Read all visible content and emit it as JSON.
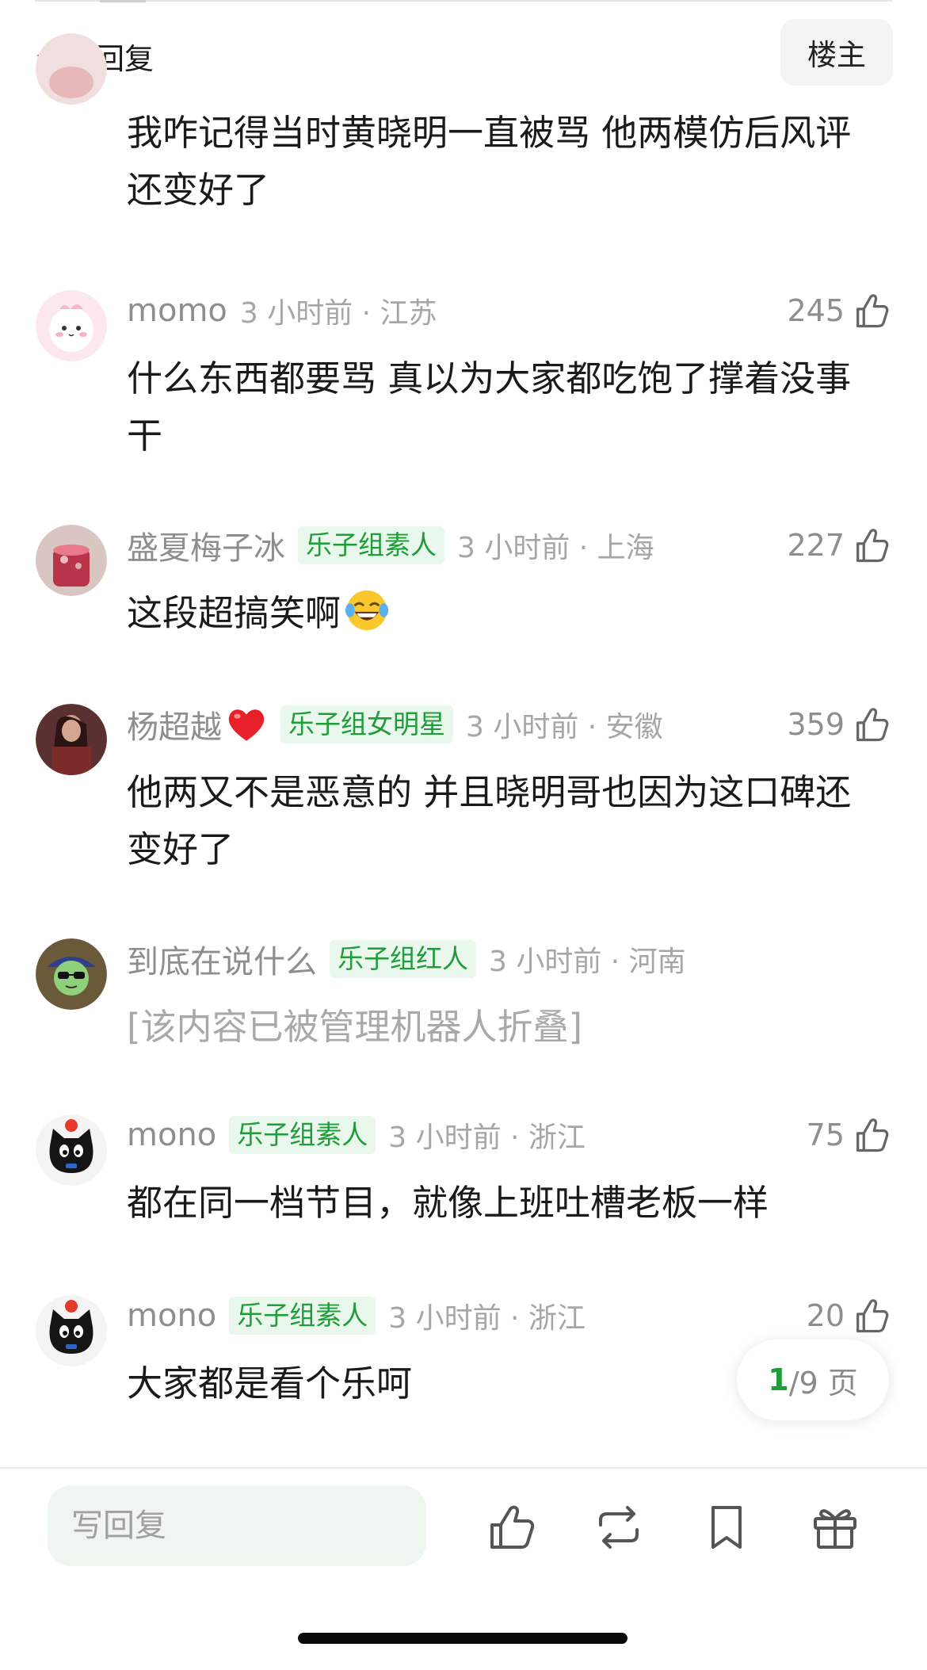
{
  "header": {
    "title": "全部回复",
    "op_label": "楼主"
  },
  "comments": [
    {
      "text": "我咋记得当时黄晓明一直被骂 他两模仿后风评还变好了"
    },
    {
      "user": "momo",
      "badge": "",
      "time_location": "3 小时前 · 江苏",
      "likes": "245",
      "text": "什么东西都要骂 真以为大家都吃饱了撑着没事干",
      "avatar": "pink-bunny-avatar"
    },
    {
      "user": "盛夏梅子冰",
      "badge": "乐子组素人",
      "time_location": "3 小时前 · 上海",
      "likes": "227",
      "text": "这段超搞笑啊",
      "avatar": "iced-drink-avatar",
      "emoji": "laughing-tears-emoji"
    },
    {
      "user": "杨超越",
      "badge": "乐子组女明星",
      "time_location": "3 小时前 · 安徽",
      "likes": "359",
      "text": "他两又不是恶意的 并且晓明哥也因为这口碑还变好了",
      "avatar": "person-avatar",
      "icon": "red-heart-icon"
    },
    {
      "user": "到底在说什么",
      "badge": "乐子组红人",
      "time_location": "3 小时前 · 河南",
      "likes": "",
      "text": "[该内容已被管理机器人折叠]",
      "avatar": "cartoon-sunglasses-avatar"
    },
    {
      "user": "mono",
      "badge": "乐子组素人",
      "time_location": "3 小时前 · 浙江",
      "likes": "75",
      "text": "都在同一档节目，就像上班吐槽老板一样",
      "avatar": "black-cat-avatar"
    },
    {
      "user": "mono",
      "badge": "乐子组素人",
      "time_location": "3 小时前 · 浙江",
      "likes": "20",
      "text": "大家都是看个乐呵",
      "avatar": "black-cat-avatar"
    }
  ],
  "pagination": {
    "current": "1",
    "total": "/9 页"
  },
  "bottom_bar": {
    "reply_placeholder": "写回复",
    "icons": [
      "thumbs-up-icon",
      "repost-icon",
      "bookmark-icon",
      "gift-icon"
    ]
  },
  "colors": {
    "accent_green": "#1f9d3a",
    "badge_bg": "#eaf7ec",
    "muted_text": "#8e8e8e",
    "input_bg": "#eff5ef"
  }
}
